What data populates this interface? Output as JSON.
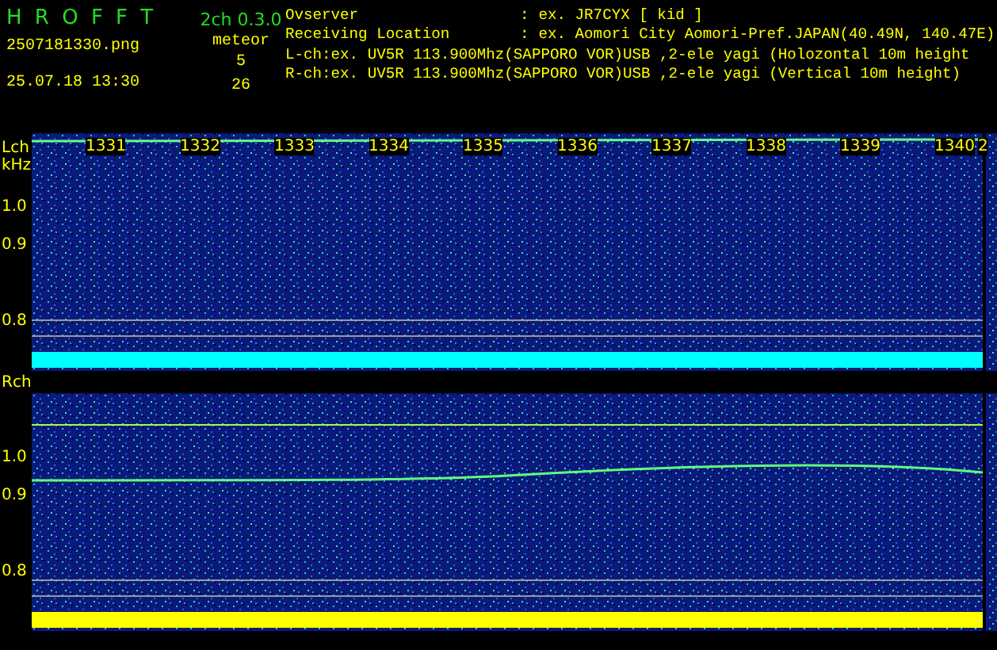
{
  "header": {
    "app_title": "H R O F F T",
    "version": "2ch 0.3.0",
    "filename": "2507181330.png",
    "datetime": "25.07.18 13:30",
    "meteor_label": "meteor",
    "meteor_counts": [
      "5",
      "26"
    ],
    "info": [
      {
        "kind": "field",
        "label": "Ovserver",
        "separator": ":",
        "value": "ex. JR7CYX [ kid ]"
      },
      {
        "kind": "field",
        "label": "Receiving Location",
        "separator": ":",
        "value": "ex. Aomori City Aomori-Pref.JAPAN(40.49N, 140.47E)"
      },
      {
        "kind": "line",
        "value": "L-ch:ex. UV5R 113.900Mhz(SAPPORO VOR)USB ,2-ele yagi (Holozontal 10m height"
      },
      {
        "kind": "line",
        "value": "R-ch:ex. UV5R 113.900Mhz(SAPPORO VOR)USB ,2-ele yagi (Vertical 10m height)"
      }
    ]
  },
  "panels": [
    {
      "channel": "Lch",
      "unit": "kHz",
      "ticks": [
        "1.0",
        "0.9",
        "0.8"
      ],
      "color": "#00ffff",
      "time_labels": [
        "1331",
        "1332",
        "1333",
        "1334",
        "1335",
        "1336",
        "1337",
        "1338",
        "1339",
        "1340",
        "2"
      ]
    },
    {
      "channel": "Rch",
      "ticks": [
        "1.0",
        "0.9",
        "0.8"
      ],
      "color": "#ffff00"
    }
  ]
}
